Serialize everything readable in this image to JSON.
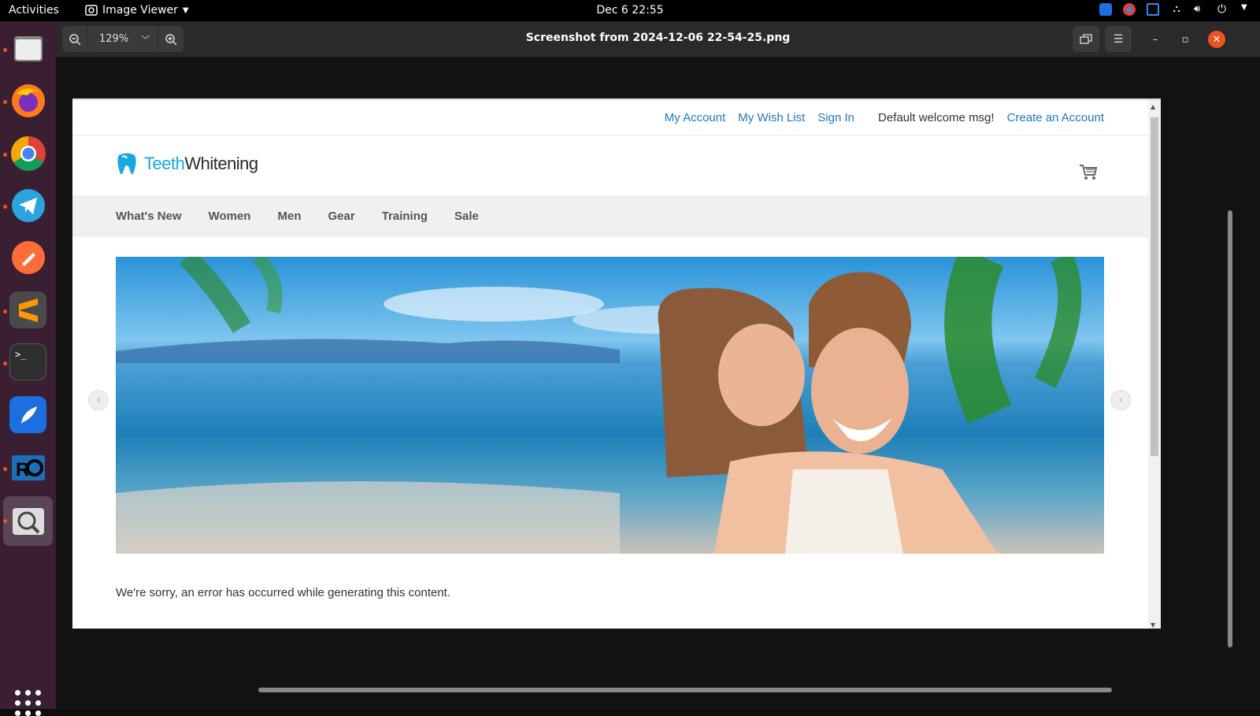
{
  "topbar": {
    "activities": "Activities",
    "app_name": "Image Viewer",
    "clock": "Dec 6  22:55"
  },
  "dock": {
    "items": [
      "Files",
      "Firefox",
      "Chrome",
      "Telegram",
      "Postman",
      "Sublime Text",
      "Terminal",
      "Feather",
      "RO",
      "Image Viewer"
    ]
  },
  "viewer": {
    "zoom": "129%",
    "title": "Screenshot from 2024-12-06 22-54-25.png"
  },
  "site": {
    "links": {
      "my_account": "My Account",
      "wish_list": "My Wish List",
      "sign_in": "Sign In",
      "welcome": "Default welcome msg!",
      "create_account": "Create an Account"
    },
    "logo": {
      "word1": "Teeth",
      "word2": "Whitening"
    },
    "nav": [
      "What's New",
      "Women",
      "Men",
      "Gear",
      "Training",
      "Sale"
    ],
    "error": "We're sorry, an error has occurred while generating this content."
  },
  "colors": {
    "accent": "#e95420",
    "link": "#1979c3",
    "logo_blue": "#1aa6e0"
  }
}
